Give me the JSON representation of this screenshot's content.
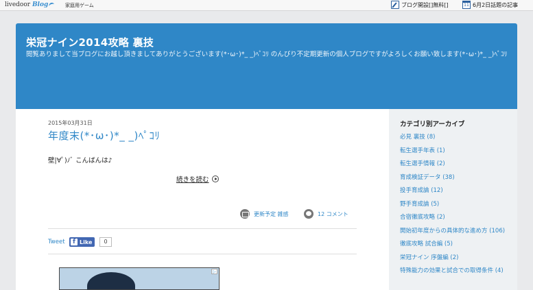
{
  "topbar": {
    "logo_text": "livedoor",
    "logo_blog": "Blog",
    "game_link": "家庭用ゲーム",
    "blog_open": "ブログ開設[]無料[]",
    "topic_date": "11",
    "topic_link": "6月2日話題の記事"
  },
  "header": {
    "title": "栄冠ナイン2014攻略 裏技",
    "description": "閲覧ありまして当ブログにお越し頂きましてありがとうございます(*･ω･)*_ _)ﾍﾟｺﾘ のんびり不定期更新の個人ブログですがよろしくお願い致します(*･ω･)*_ _)ﾍﾟｺﾘ"
  },
  "post": {
    "date": "2015年03月31日",
    "title": "年度末(*･ω･)*_ _)ﾍﾟｺﾘ",
    "body": "壁|∀ﾟ)ﾉﾞ こんばんは♪",
    "read_more": "続きを読む",
    "category": "更新予定 雑感",
    "comments": "12 コメント"
  },
  "social": {
    "tweet": "Tweet",
    "fb_icon": "f",
    "like": "Like",
    "like_count": "0"
  },
  "ad": {
    "adchoices": "▷"
  },
  "sidebar": {
    "heading": "カテゴリ別アーカイブ",
    "categories": [
      "必見 裏技 (8)",
      "転生選手年表 (1)",
      "転生選手情報 (2)",
      "育成検証データ (38)",
      "投手育成論 (12)",
      "野手育成論 (5)",
      "合宿徹底攻略 (2)",
      "開始初年度からの具体的な進め方 (106)",
      "徹底攻略 試合編 (5)",
      "栄冠ナイン 序盤編 (2)",
      "特殊能力の効果と試合での取得条件 (4)"
    ]
  },
  "colors": {
    "header_bg": "#2f87c7",
    "link": "#2f87c7",
    "page_bg": "#e9eaec",
    "fb_blue": "#4267b2"
  }
}
